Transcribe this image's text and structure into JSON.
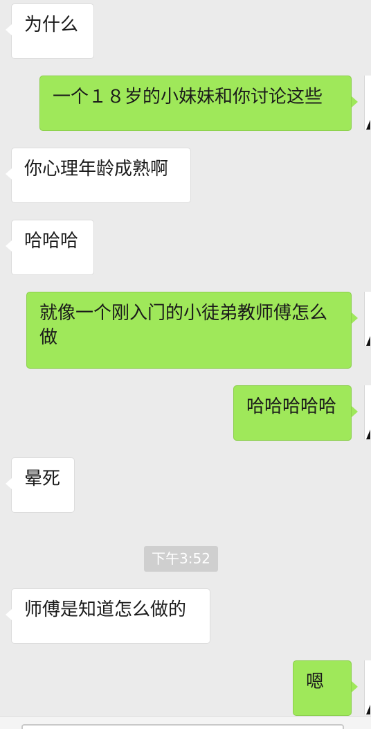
{
  "messages": [
    {
      "direction": "in",
      "text": "为什么"
    },
    {
      "direction": "out",
      "text": "一个１８岁的小妹妹和你讨论这些"
    },
    {
      "direction": "in",
      "text": "你心理年龄成熟啊"
    },
    {
      "direction": "in",
      "text": "哈哈哈"
    },
    {
      "direction": "out",
      "text": "就像一个刚入门的小徒弟教师傅怎么做"
    },
    {
      "direction": "out",
      "text": "哈哈哈哈哈"
    },
    {
      "direction": "in",
      "text": "晕死"
    },
    {
      "direction": "in",
      "text": "师傅是知道怎么做的"
    },
    {
      "direction": "out",
      "text": "嗯"
    }
  ],
  "timestamp": "下午3:52",
  "colors": {
    "background": "#ebebeb",
    "incoming_bubble": "#ffffff",
    "outgoing_bubble": "#9fe85a",
    "timestamp_bg": "#cfcfcf"
  }
}
